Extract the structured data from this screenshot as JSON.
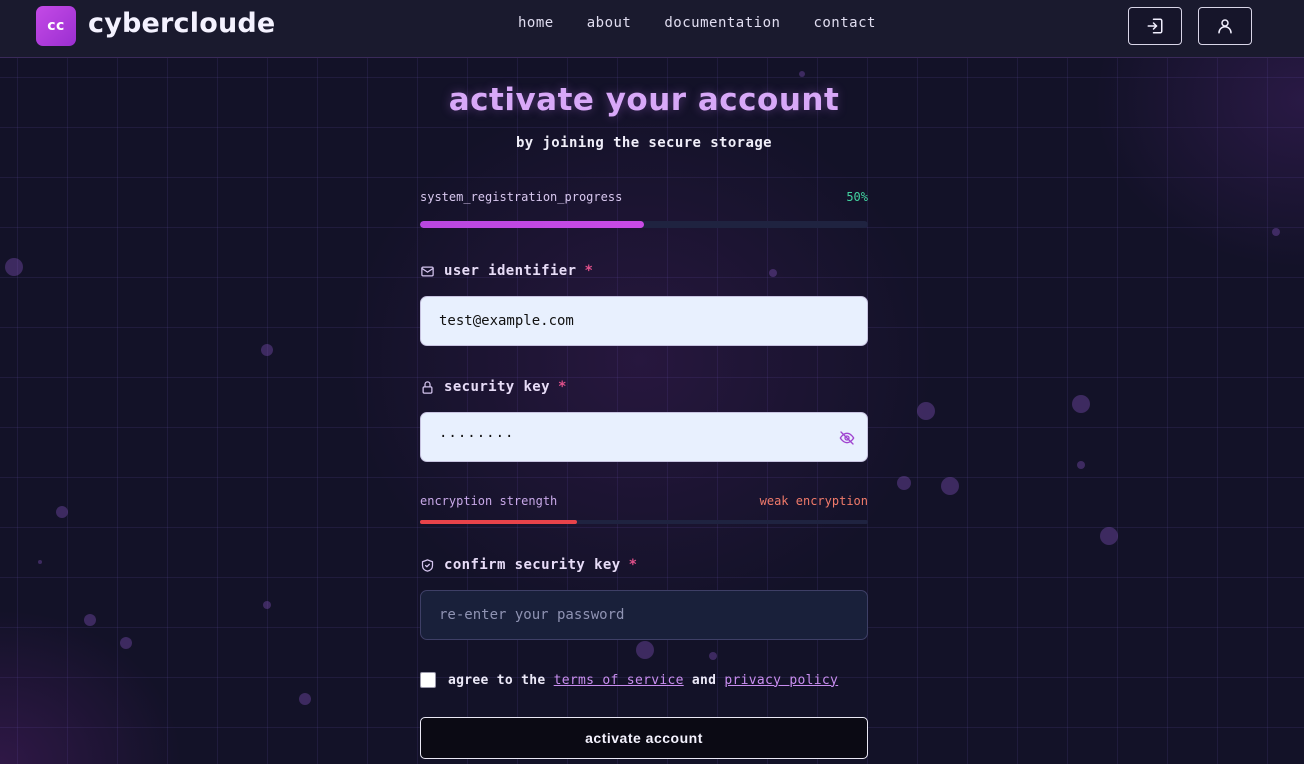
{
  "brand": {
    "logo_initials": "cc",
    "name": "cybercloude"
  },
  "nav": {
    "links": [
      "home",
      "about",
      "documentation",
      "contact"
    ]
  },
  "header_icons": [
    "login-icon",
    "user-icon"
  ],
  "form": {
    "title": "activate your account",
    "subtitle": "by joining the secure storage",
    "progress": {
      "label": "system_registration_progress",
      "value": "50%",
      "fraction": 0.5
    },
    "email": {
      "label": "user identifier",
      "required_mark": "*",
      "value": "test@example.com",
      "icon": "mail-icon"
    },
    "password": {
      "label": "security key",
      "required_mark": "*",
      "value": "········",
      "icon": "lock-icon",
      "toggle_icon": "eye-off-icon"
    },
    "strength": {
      "label": "encryption strength",
      "value": "weak encryption",
      "fraction": 0.35
    },
    "confirm": {
      "label": "confirm security key",
      "required_mark": "*",
      "placeholder": "re-enter your password",
      "icon": "shield-check-icon"
    },
    "terms": {
      "prefix": "agree to the",
      "link1": "terms of service",
      "middle": "and",
      "link2": "privacy policy",
      "checked": false
    },
    "submit_label": "activate account"
  },
  "colors": {
    "accent": "#c44ae6",
    "title": "#d8a8f8",
    "success": "#42d3a0",
    "danger": "#e8434a"
  }
}
